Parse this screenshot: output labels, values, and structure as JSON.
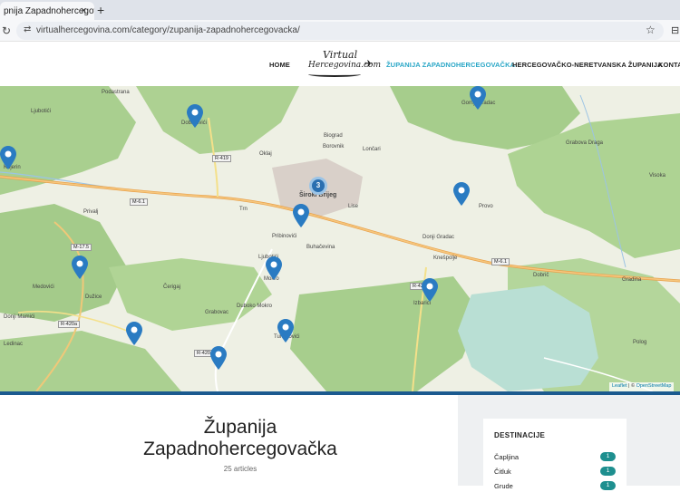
{
  "browser": {
    "tab_title": "pnija Zapadnohercegovačka",
    "tab_close": "×",
    "new_tab": "+",
    "reload": "↻",
    "site_info": "⇄",
    "url": "virtualhercegovina.com/category/zupanija-zapadnohercegovacka/",
    "bookmark": "☆",
    "extensions": "⊟"
  },
  "header": {
    "logo_line1": "Virtual",
    "logo_line2": "Hercegovina.com",
    "logo_plane": "✈",
    "nav": [
      {
        "label": "HOME",
        "active": false
      },
      {
        "label": "ŽUPANIJA ZAPADNOHERCEGOVAČKA",
        "active": true
      },
      {
        "label": "HERCEGOVAČKO-NERETVANSKA ŽUPANIJA",
        "active": false
      },
      {
        "label": "KONTA",
        "active": false
      }
    ]
  },
  "map": {
    "places": [
      "Podastrana",
      "Ljubotići",
      "Dobrkovići",
      "Oklaj",
      "Lončari",
      "Gornji Gradac",
      "Grabova Draga",
      "Knjerin",
      "Privalj",
      "Široki Brijeg",
      "Lise",
      "Provo",
      "Pribinovići",
      "Buhačevina",
      "Donji Gradac",
      "Knešpolje",
      "Dobrič",
      "Medovići",
      "Dužice",
      "Ljubotići",
      "Mokro",
      "Donji Mamići",
      "Čerigaj",
      "Duboko Mokro",
      "Ledinac",
      "Turčinovići",
      "Izbarici",
      "Polog",
      "Gradina",
      "Visoka",
      "Grabovac",
      "Trn",
      "Biograd",
      "Borovnik"
    ],
    "roads": [
      "R-419",
      "M-6.1",
      "M-6.1",
      "M-17.5",
      "R-420a",
      "R-424",
      "R-420a"
    ],
    "cluster_count": "3",
    "attribution_leaflet": "Leaflet",
    "attribution_sep": " | © ",
    "attribution_osm": "OpenStreetMap"
  },
  "main": {
    "title_line1": "Županija",
    "title_line2": "Zapadnohercegovačka",
    "article_count": "25 articles"
  },
  "sidebar": {
    "widget_title": "DESTINACIJE",
    "destinations": [
      {
        "name": "Čapljina",
        "count": "1"
      },
      {
        "name": "Čitluk",
        "count": "1"
      },
      {
        "name": "Grude",
        "count": "1"
      }
    ]
  },
  "colors": {
    "accent": "#2aa7c7",
    "marker": "#2a7bc2",
    "badge": "#1e8f8f",
    "map_bar": "#1b5a8f"
  }
}
